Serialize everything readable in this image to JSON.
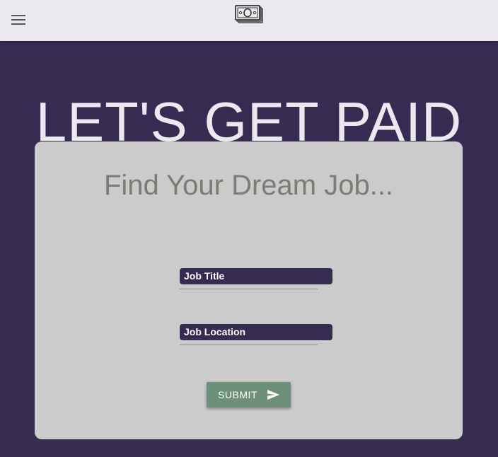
{
  "appbar": {
    "menu_icon": "hamburger-menu-icon",
    "logo_icon": "money-stack-icon",
    "background": "#ebe9ee"
  },
  "hero": {
    "title": "LET'S GET PAID"
  },
  "search_card": {
    "title": "Find Your Dream Job...",
    "job_title_label": "Job Title",
    "job_title_value": "",
    "job_location_label": "Job Location",
    "job_location_value": "",
    "submit_label": "SUBMIT",
    "submit_icon": "send-icon"
  },
  "colors": {
    "page_background": "#382b52",
    "card_background": "#cbcbcb",
    "card_title": "#7d7b72",
    "field_label_background": "#382b52",
    "submit_background": "#6d9178"
  }
}
